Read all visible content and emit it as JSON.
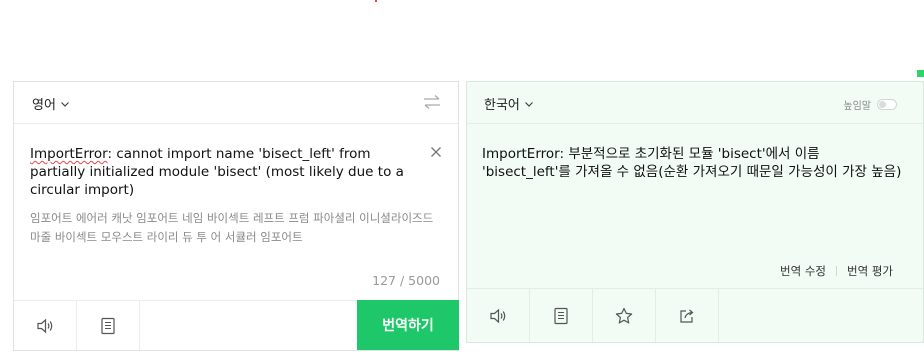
{
  "source": {
    "language": "영어",
    "error_word": "ImportError",
    "text_rest": ": cannot import name 'bisect_left' from partially initialized module 'bisect' (most likely due to a circular import)",
    "pronunciation": "임포어트 에어러 캐낫 임포어트 네임 바이섹트 레프트 프럼 파아셜리 이니셜라이즈드 마줄 바이섹트 모우스트 라이리 듀 투 어 서큘러 임포어트",
    "char_count": "127 / 5000",
    "translate_button": "번역하기"
  },
  "target": {
    "language": "한국어",
    "honorific_label": "높임말",
    "text": "ImportError: 부분적으로 초기화된 모듈 'bisect'에서 이름 'bisect_left'를 가져올 수 없음(순환 가져오기 때문일 가능성이 가장 높음)",
    "edit_translation": "번역 수정",
    "rate_translation": "번역 평가"
  },
  "colors": {
    "accent_green": "#1ec86a",
    "result_bg": "#f2fbf4"
  },
  "icons": {
    "source_lang_chevron": "chevron-down-icon",
    "swap": "swap-arrows-icon",
    "clear": "close-icon",
    "listen": "speaker-icon",
    "dictionary": "book-icon",
    "favorite": "star-icon",
    "share": "share-icon"
  }
}
